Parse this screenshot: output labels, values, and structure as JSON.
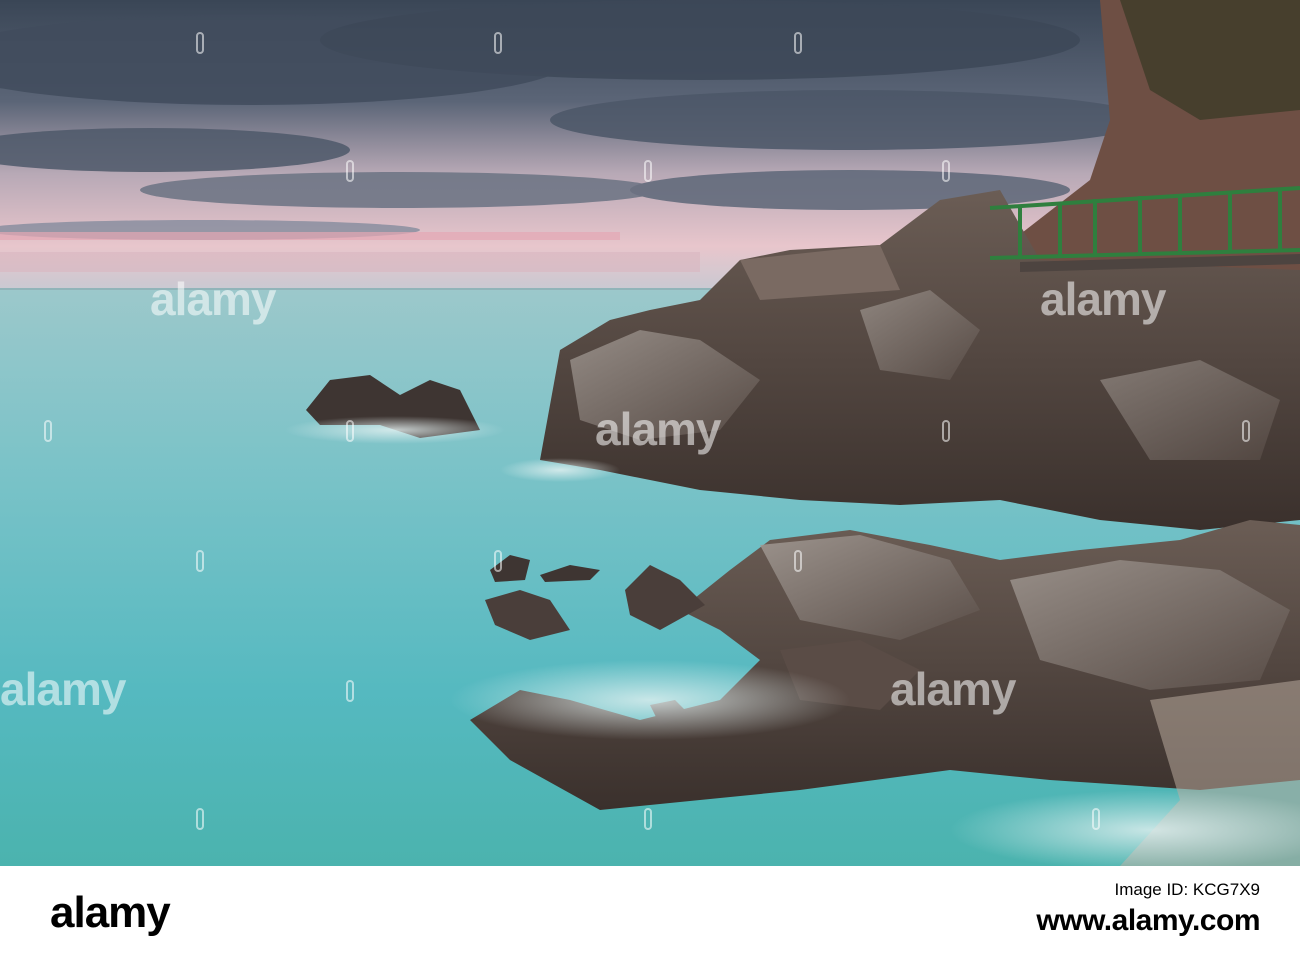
{
  "watermark": {
    "text": "alamy"
  },
  "footer": {
    "logo": "alamy",
    "image_id_label": "Image ID: ",
    "image_id": "KCG7X9",
    "site": "www.alamy.com"
  },
  "colors": {
    "sky_top": "#3c4a5c",
    "sky_glow": "#e9c5c9",
    "sea_far": "#8fc3c8",
    "sea_near": "#4fb8bf",
    "rock_dark": "#3f3632",
    "rock_light": "#9a928c",
    "railing": "#2f7f3e"
  }
}
